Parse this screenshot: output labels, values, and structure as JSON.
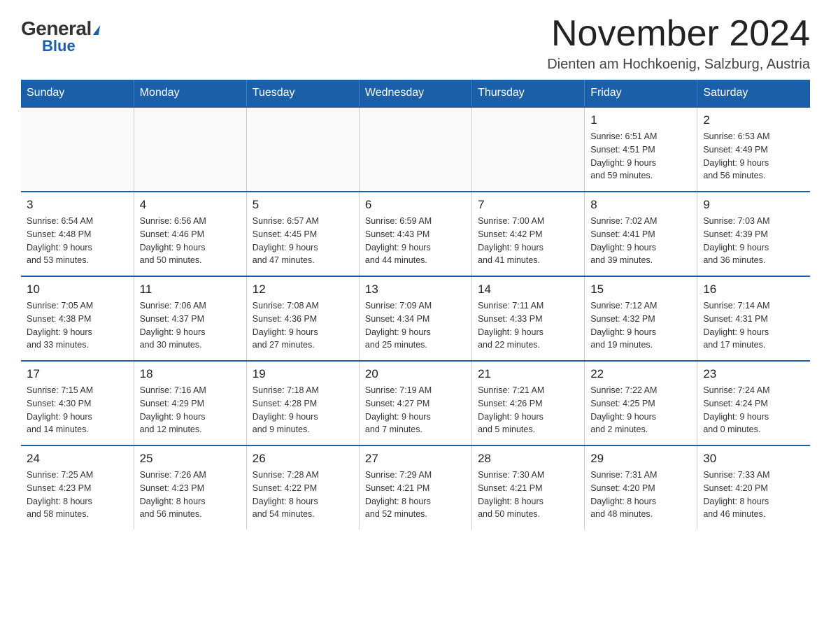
{
  "logo": {
    "general": "General",
    "blue": "Blue",
    "triangle_hint": "logo triangle shape"
  },
  "header": {
    "month_title": "November 2024",
    "location": "Dienten am Hochkoenig, Salzburg, Austria"
  },
  "weekdays": [
    "Sunday",
    "Monday",
    "Tuesday",
    "Wednesday",
    "Thursday",
    "Friday",
    "Saturday"
  ],
  "weeks": [
    [
      {
        "day": "",
        "info": ""
      },
      {
        "day": "",
        "info": ""
      },
      {
        "day": "",
        "info": ""
      },
      {
        "day": "",
        "info": ""
      },
      {
        "day": "",
        "info": ""
      },
      {
        "day": "1",
        "info": "Sunrise: 6:51 AM\nSunset: 4:51 PM\nDaylight: 9 hours\nand 59 minutes."
      },
      {
        "day": "2",
        "info": "Sunrise: 6:53 AM\nSunset: 4:49 PM\nDaylight: 9 hours\nand 56 minutes."
      }
    ],
    [
      {
        "day": "3",
        "info": "Sunrise: 6:54 AM\nSunset: 4:48 PM\nDaylight: 9 hours\nand 53 minutes."
      },
      {
        "day": "4",
        "info": "Sunrise: 6:56 AM\nSunset: 4:46 PM\nDaylight: 9 hours\nand 50 minutes."
      },
      {
        "day": "5",
        "info": "Sunrise: 6:57 AM\nSunset: 4:45 PM\nDaylight: 9 hours\nand 47 minutes."
      },
      {
        "day": "6",
        "info": "Sunrise: 6:59 AM\nSunset: 4:43 PM\nDaylight: 9 hours\nand 44 minutes."
      },
      {
        "day": "7",
        "info": "Sunrise: 7:00 AM\nSunset: 4:42 PM\nDaylight: 9 hours\nand 41 minutes."
      },
      {
        "day": "8",
        "info": "Sunrise: 7:02 AM\nSunset: 4:41 PM\nDaylight: 9 hours\nand 39 minutes."
      },
      {
        "day": "9",
        "info": "Sunrise: 7:03 AM\nSunset: 4:39 PM\nDaylight: 9 hours\nand 36 minutes."
      }
    ],
    [
      {
        "day": "10",
        "info": "Sunrise: 7:05 AM\nSunset: 4:38 PM\nDaylight: 9 hours\nand 33 minutes."
      },
      {
        "day": "11",
        "info": "Sunrise: 7:06 AM\nSunset: 4:37 PM\nDaylight: 9 hours\nand 30 minutes."
      },
      {
        "day": "12",
        "info": "Sunrise: 7:08 AM\nSunset: 4:36 PM\nDaylight: 9 hours\nand 27 minutes."
      },
      {
        "day": "13",
        "info": "Sunrise: 7:09 AM\nSunset: 4:34 PM\nDaylight: 9 hours\nand 25 minutes."
      },
      {
        "day": "14",
        "info": "Sunrise: 7:11 AM\nSunset: 4:33 PM\nDaylight: 9 hours\nand 22 minutes."
      },
      {
        "day": "15",
        "info": "Sunrise: 7:12 AM\nSunset: 4:32 PM\nDaylight: 9 hours\nand 19 minutes."
      },
      {
        "day": "16",
        "info": "Sunrise: 7:14 AM\nSunset: 4:31 PM\nDaylight: 9 hours\nand 17 minutes."
      }
    ],
    [
      {
        "day": "17",
        "info": "Sunrise: 7:15 AM\nSunset: 4:30 PM\nDaylight: 9 hours\nand 14 minutes."
      },
      {
        "day": "18",
        "info": "Sunrise: 7:16 AM\nSunset: 4:29 PM\nDaylight: 9 hours\nand 12 minutes."
      },
      {
        "day": "19",
        "info": "Sunrise: 7:18 AM\nSunset: 4:28 PM\nDaylight: 9 hours\nand 9 minutes."
      },
      {
        "day": "20",
        "info": "Sunrise: 7:19 AM\nSunset: 4:27 PM\nDaylight: 9 hours\nand 7 minutes."
      },
      {
        "day": "21",
        "info": "Sunrise: 7:21 AM\nSunset: 4:26 PM\nDaylight: 9 hours\nand 5 minutes."
      },
      {
        "day": "22",
        "info": "Sunrise: 7:22 AM\nSunset: 4:25 PM\nDaylight: 9 hours\nand 2 minutes."
      },
      {
        "day": "23",
        "info": "Sunrise: 7:24 AM\nSunset: 4:24 PM\nDaylight: 9 hours\nand 0 minutes."
      }
    ],
    [
      {
        "day": "24",
        "info": "Sunrise: 7:25 AM\nSunset: 4:23 PM\nDaylight: 8 hours\nand 58 minutes."
      },
      {
        "day": "25",
        "info": "Sunrise: 7:26 AM\nSunset: 4:23 PM\nDaylight: 8 hours\nand 56 minutes."
      },
      {
        "day": "26",
        "info": "Sunrise: 7:28 AM\nSunset: 4:22 PM\nDaylight: 8 hours\nand 54 minutes."
      },
      {
        "day": "27",
        "info": "Sunrise: 7:29 AM\nSunset: 4:21 PM\nDaylight: 8 hours\nand 52 minutes."
      },
      {
        "day": "28",
        "info": "Sunrise: 7:30 AM\nSunset: 4:21 PM\nDaylight: 8 hours\nand 50 minutes."
      },
      {
        "day": "29",
        "info": "Sunrise: 7:31 AM\nSunset: 4:20 PM\nDaylight: 8 hours\nand 48 minutes."
      },
      {
        "day": "30",
        "info": "Sunrise: 7:33 AM\nSunset: 4:20 PM\nDaylight: 8 hours\nand 46 minutes."
      }
    ]
  ]
}
